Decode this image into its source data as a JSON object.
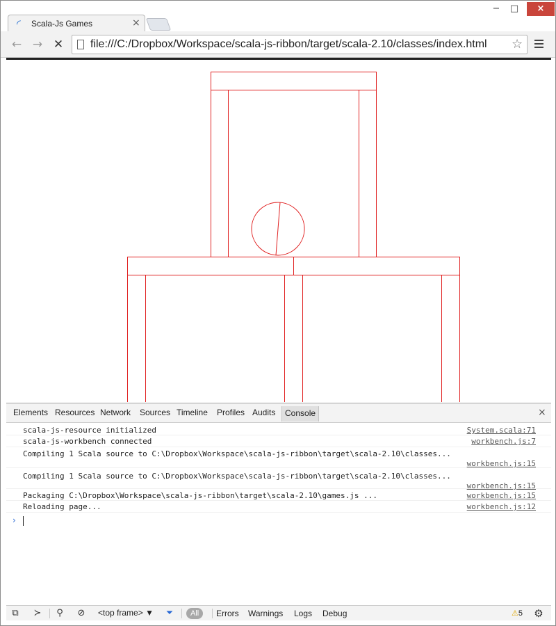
{
  "browser": {
    "tab": {
      "title": "Scala-Js Games",
      "close_glyph": "×",
      "favicon": "loading-spinner-icon"
    },
    "window_controls": {
      "minimize": "−",
      "maximize": "□",
      "close": "×"
    },
    "toolbar": {
      "back_glyph": "←",
      "forward_glyph": "→",
      "stop_glyph": "✕",
      "url": "file:///C:/Dropbox/Workspace/scala-js-ribbon/target/scala-2.10/classes/index.html",
      "star_glyph": "☆"
    }
  },
  "scene": {
    "stroke_color": "#e02020",
    "shapes": [
      "top-plank",
      "left-upper-pillar",
      "right-upper-pillar",
      "ball",
      "left-middle-plank",
      "right-middle-plank",
      "left-lower-pillar",
      "center-lower-pillar",
      "right-lower-pillar"
    ]
  },
  "devtools": {
    "tabs": [
      "Elements",
      "Resources",
      "Network",
      "Sources",
      "Timeline",
      "Profiles",
      "Audits"
    ],
    "active_tab": "Console",
    "close_glyph": "×",
    "console": {
      "messages": [
        {
          "text": "scala-js-resource initialized",
          "source": "System.scala:71"
        },
        {
          "text": "scala-js-workbench connected",
          "source": "workbench.js:7"
        },
        {
          "text": "Compiling 1 Scala source to C:\\Dropbox\\Workspace\\scala-js-ribbon\\target\\scala-2.10\\classes...",
          "source": "workbench.js:15"
        },
        {
          "text": "Compiling 1 Scala source to C:\\Dropbox\\Workspace\\scala-js-ribbon\\target\\scala-2.10\\classes...",
          "source": "workbench.js:15"
        },
        {
          "text": "Packaging C:\\Dropbox\\Workspace\\scala-js-ribbon\\target\\scala-2.10\\games.js ...",
          "source": "workbench.js:15"
        },
        {
          "text": "Reloading page...",
          "source": "workbench.js:12"
        }
      ],
      "prompt_glyph": "›"
    },
    "bottom_bar": {
      "frame_select": "<top frame>",
      "frame_arrow": "▼",
      "filter_all": "All",
      "filters": [
        "Errors",
        "Warnings",
        "Logs",
        "Debug"
      ],
      "warning_count": "5",
      "warning_glyph": "⚠"
    }
  }
}
